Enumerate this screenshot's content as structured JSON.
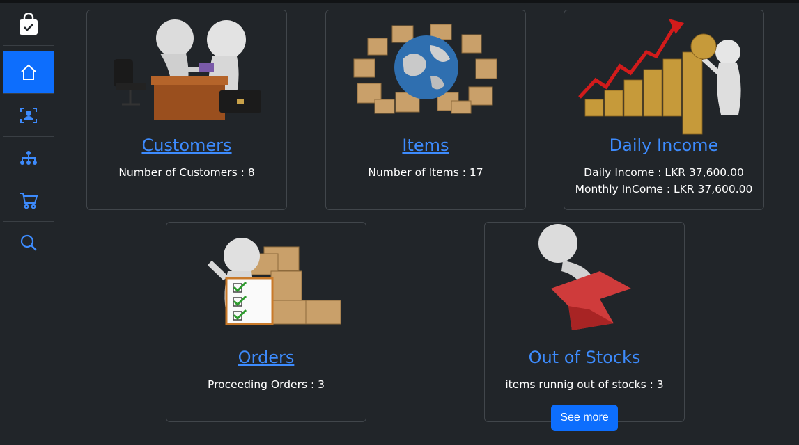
{
  "sidebar": {
    "items": [
      {
        "icon": "shopping-bag-check-icon"
      },
      {
        "icon": "home-icon",
        "active": true
      },
      {
        "icon": "person-badge-icon"
      },
      {
        "icon": "diagram-icon"
      },
      {
        "icon": "cart-icon"
      },
      {
        "icon": "search-icon"
      }
    ]
  },
  "colors": {
    "accent": "#0d6efd",
    "link": "#3d8bfd",
    "background": "#212529"
  },
  "cards": {
    "customers": {
      "title": "Customers",
      "line1": "Number of Customers : 8"
    },
    "items": {
      "title": "Items",
      "line1": "Number of Items : 17"
    },
    "income": {
      "title": "Daily Income",
      "line1": "Daily Income : LKR 37,600.00",
      "line2": "Monthly InCome : LKR 37,600.00"
    },
    "orders": {
      "title": "Orders",
      "line1": "Proceeding Orders : 3"
    },
    "stocks": {
      "title": "Out of Stocks",
      "line1": "items runnig out of stocks : 3",
      "button": "See more"
    }
  }
}
